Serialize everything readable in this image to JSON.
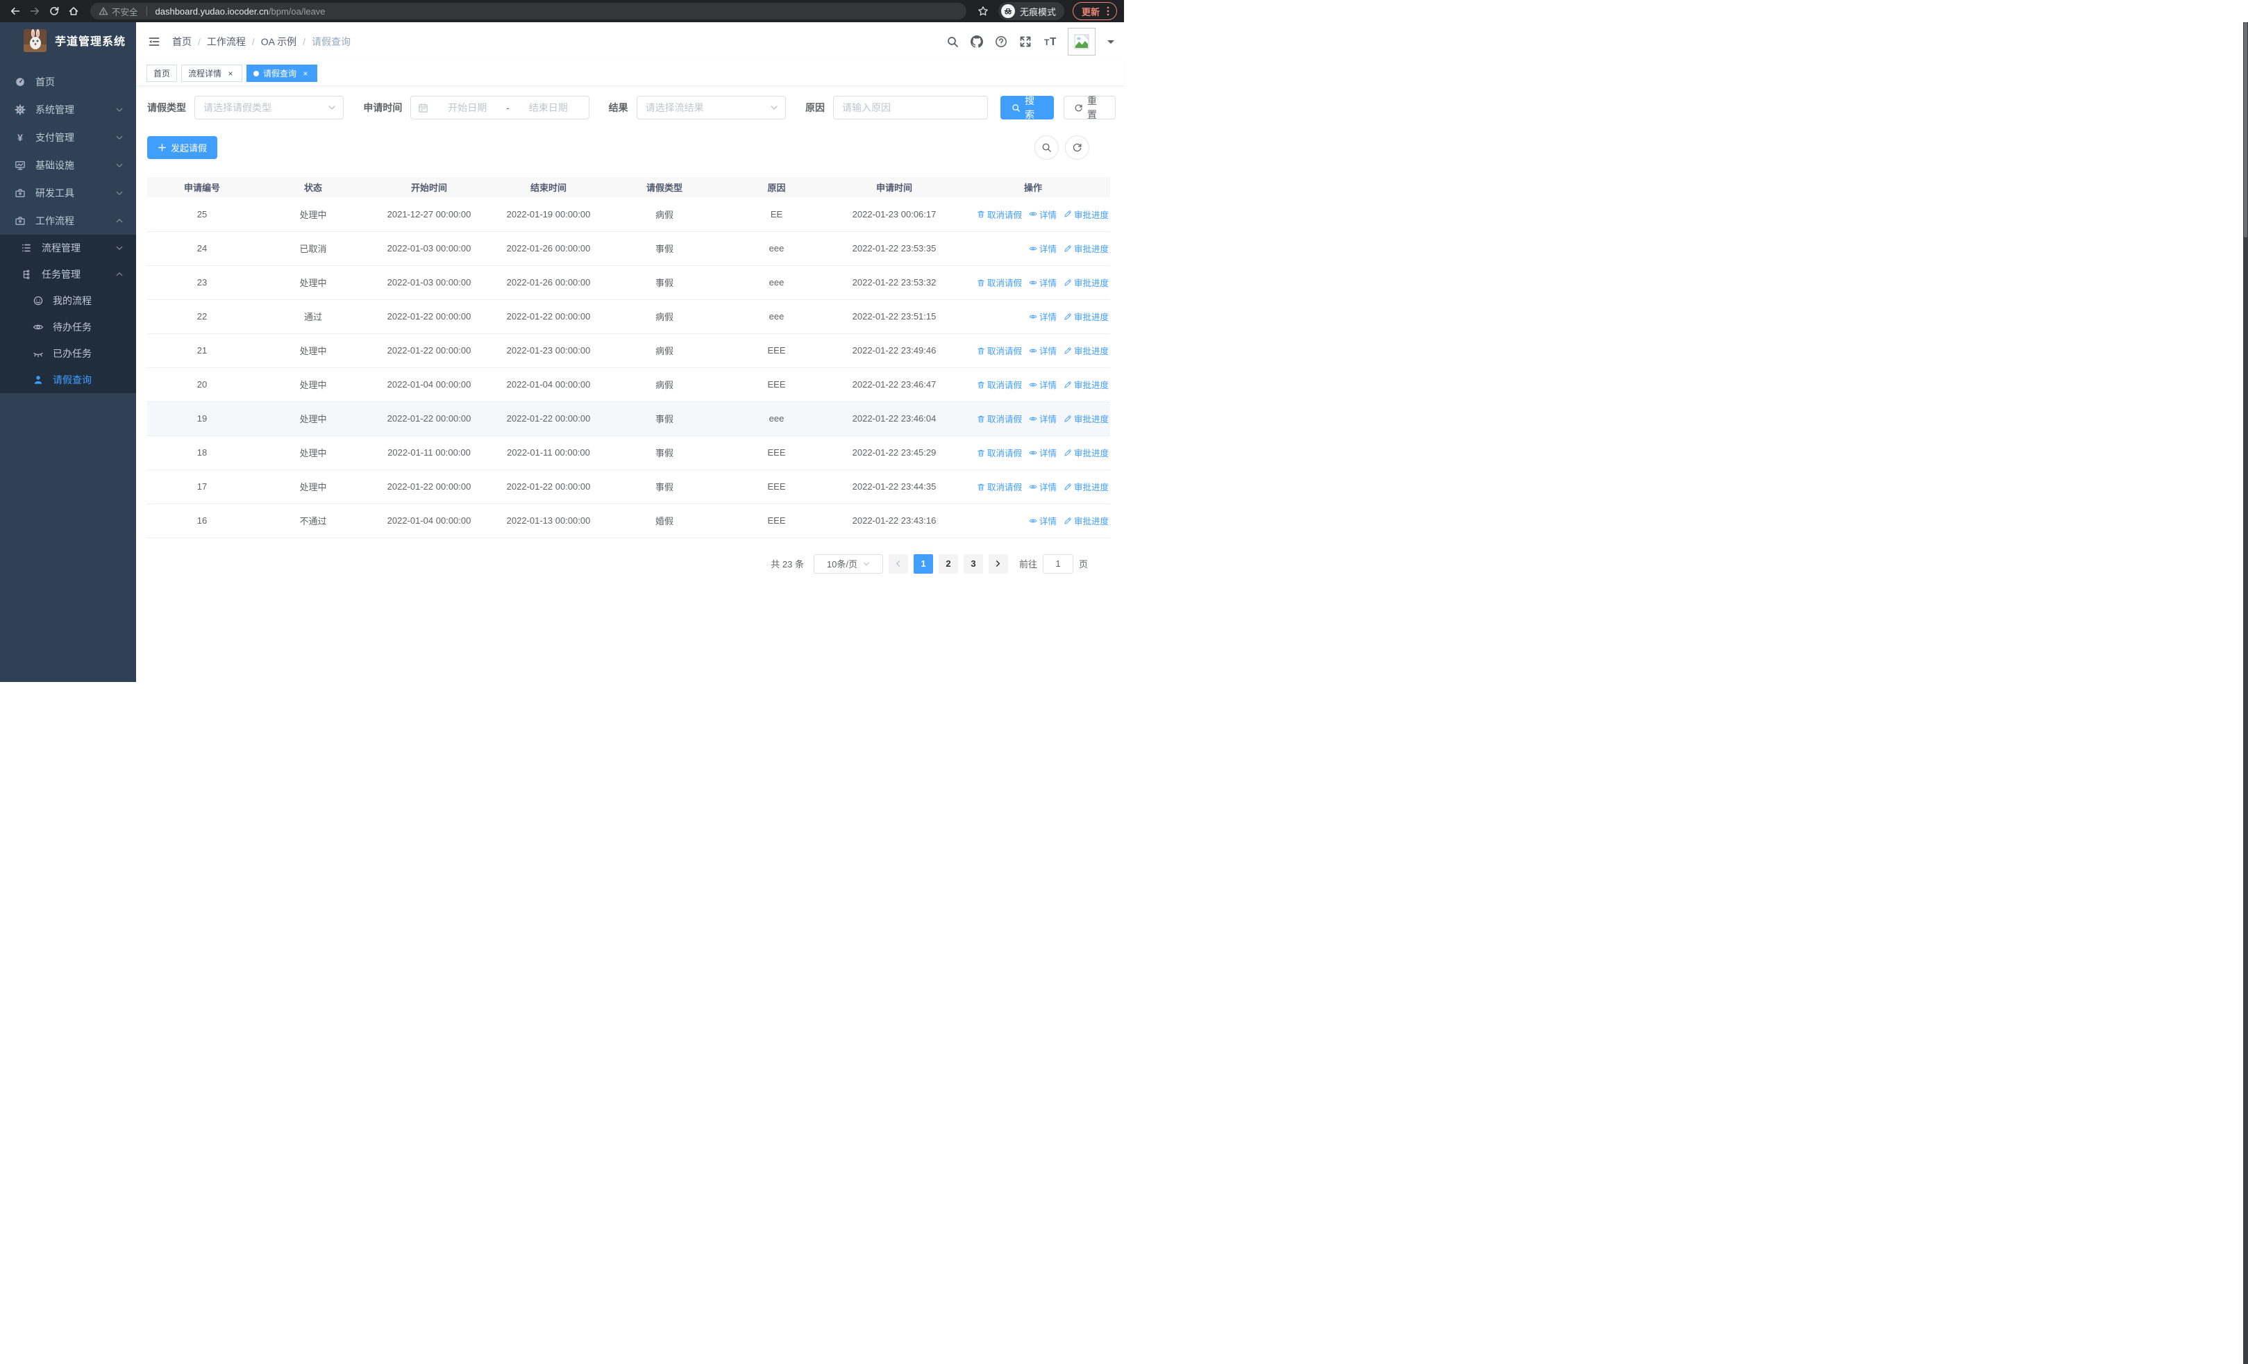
{
  "colors": {
    "accent": "#409eff",
    "sidebar_bg": "#304156",
    "submenu_bg": "#1f2d3d",
    "active_tag": "#409eff"
  },
  "browser": {
    "security_warning": "不安全",
    "url_host": "dashboard.yudao.iocoder.cn",
    "url_path": "/bpm/oa/leave",
    "incognito_label": "无痕模式",
    "update_label": "更新"
  },
  "sidebar": {
    "logo_title": "芋道管理系统",
    "items": [
      {
        "label": "首页",
        "icon": "dashboard-icon",
        "level": 1
      },
      {
        "label": "系统管理",
        "icon": "gear-icon",
        "level": 1,
        "chevron": "down"
      },
      {
        "label": "支付管理",
        "icon": "yen-icon",
        "level": 1,
        "chevron": "down"
      },
      {
        "label": "基础设施",
        "icon": "monitor-icon",
        "level": 1,
        "chevron": "down"
      },
      {
        "label": "研发工具",
        "icon": "toolbox-icon",
        "level": 1,
        "chevron": "down"
      },
      {
        "label": "工作流程",
        "icon": "briefcase-icon",
        "level": 1,
        "chevron": "up"
      },
      {
        "label": "流程管理",
        "icon": "list-icon",
        "level": 2,
        "chevron": "down",
        "dark": true
      },
      {
        "label": "任务管理",
        "icon": "tree-icon",
        "level": 2,
        "chevron": "up",
        "dark": true
      },
      {
        "label": "我的流程",
        "icon": "face-icon",
        "level": 3,
        "dark": true
      },
      {
        "label": "待办任务",
        "icon": "eye-open-icon",
        "level": 3,
        "dark": true
      },
      {
        "label": "已办任务",
        "icon": "eye-closed-icon",
        "level": 3,
        "dark": true
      },
      {
        "label": "请假查询",
        "icon": "user-icon",
        "level": 3,
        "dark": true,
        "active": true
      }
    ]
  },
  "header": {
    "breadcrumb": [
      "首页",
      "工作流程",
      "OA 示例",
      "请假查询"
    ],
    "right_icons": [
      "search-icon",
      "github-icon",
      "question-icon",
      "fullscreen-icon",
      "fontsize-icon"
    ]
  },
  "tabs": [
    {
      "label": "首页",
      "closable": false,
      "active": false
    },
    {
      "label": "流程详情",
      "closable": true,
      "active": false
    },
    {
      "label": "请假查询",
      "closable": true,
      "active": true
    }
  ],
  "filters": {
    "leave_type_label": "请假类型",
    "leave_type_placeholder": "请选择请假类型",
    "apply_time_label": "申请时间",
    "date_start_placeholder": "开始日期",
    "date_separator": "-",
    "date_end_placeholder": "结束日期",
    "result_label": "结果",
    "result_placeholder": "请选择流结果",
    "reason_label": "原因",
    "reason_placeholder": "请输入原因",
    "search_label": "搜索",
    "reset_label": "重置"
  },
  "toolbar": {
    "create_label": "发起请假"
  },
  "table": {
    "columns": [
      "申请编号",
      "状态",
      "开始时间",
      "结束时间",
      "请假类型",
      "原因",
      "申请时间",
      "操作"
    ],
    "action_labels": {
      "cancel": "取消请假",
      "detail": "详情",
      "progress": "审批进度"
    },
    "rows": [
      {
        "id": "25",
        "status": "处理中",
        "start": "2021-12-27 00:00:00",
        "end": "2022-01-19 00:00:00",
        "type": "病假",
        "reason": "EE",
        "apply": "2022-01-23 00:06:17",
        "actions": [
          "cancel",
          "detail",
          "progress"
        ]
      },
      {
        "id": "24",
        "status": "已取消",
        "start": "2022-01-03 00:00:00",
        "end": "2022-01-26 00:00:00",
        "type": "事假",
        "reason": "eee",
        "apply": "2022-01-22 23:53:35",
        "actions": [
          "detail",
          "progress"
        ]
      },
      {
        "id": "23",
        "status": "处理中",
        "start": "2022-01-03 00:00:00",
        "end": "2022-01-26 00:00:00",
        "type": "事假",
        "reason": "eee",
        "apply": "2022-01-22 23:53:32",
        "actions": [
          "cancel",
          "detail",
          "progress"
        ]
      },
      {
        "id": "22",
        "status": "通过",
        "start": "2022-01-22 00:00:00",
        "end": "2022-01-22 00:00:00",
        "type": "病假",
        "reason": "eee",
        "apply": "2022-01-22 23:51:15",
        "actions": [
          "detail",
          "progress"
        ]
      },
      {
        "id": "21",
        "status": "处理中",
        "start": "2022-01-22 00:00:00",
        "end": "2022-01-23 00:00:00",
        "type": "病假",
        "reason": "EEE",
        "apply": "2022-01-22 23:49:46",
        "actions": [
          "cancel",
          "detail",
          "progress"
        ]
      },
      {
        "id": "20",
        "status": "处理中",
        "start": "2022-01-04 00:00:00",
        "end": "2022-01-04 00:00:00",
        "type": "病假",
        "reason": "EEE",
        "apply": "2022-01-22 23:46:47",
        "actions": [
          "cancel",
          "detail",
          "progress"
        ]
      },
      {
        "id": "19",
        "status": "处理中",
        "start": "2022-01-22 00:00:00",
        "end": "2022-01-22 00:00:00",
        "type": "事假",
        "reason": "eee",
        "apply": "2022-01-22 23:46:04",
        "actions": [
          "cancel",
          "detail",
          "progress"
        ],
        "highlight": true
      },
      {
        "id": "18",
        "status": "处理中",
        "start": "2022-01-11 00:00:00",
        "end": "2022-01-11 00:00:00",
        "type": "事假",
        "reason": "EEE",
        "apply": "2022-01-22 23:45:29",
        "actions": [
          "cancel",
          "detail",
          "progress"
        ]
      },
      {
        "id": "17",
        "status": "处理中",
        "start": "2022-01-22 00:00:00",
        "end": "2022-01-22 00:00:00",
        "type": "事假",
        "reason": "EEE",
        "apply": "2022-01-22 23:44:35",
        "actions": [
          "cancel",
          "detail",
          "progress"
        ]
      },
      {
        "id": "16",
        "status": "不通过",
        "start": "2022-01-04 00:00:00",
        "end": "2022-01-13 00:00:00",
        "type": "婚假",
        "reason": "EEE",
        "apply": "2022-01-22 23:43:16",
        "actions": [
          "detail",
          "progress"
        ]
      }
    ]
  },
  "pagination": {
    "total_label": "共 23 条",
    "page_size": "10条/页",
    "pages": [
      "1",
      "2",
      "3"
    ],
    "active_page": "1",
    "goto_label": "前往",
    "goto_value": "1",
    "goto_unit": "页"
  }
}
